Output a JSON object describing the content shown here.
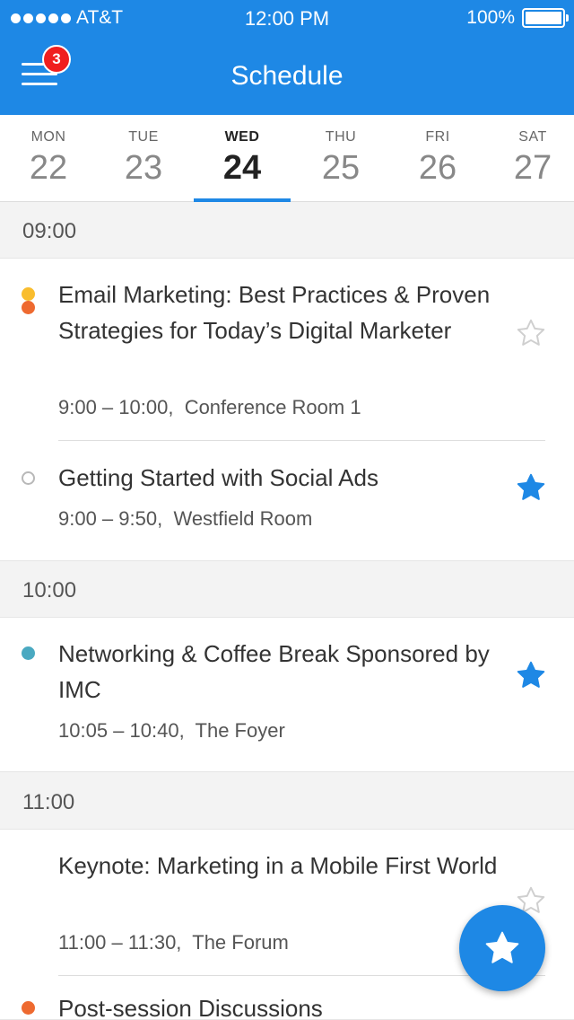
{
  "status_bar": {
    "carrier": "AT&T",
    "time": "12:00 PM",
    "battery": "100%"
  },
  "nav": {
    "title": "Schedule",
    "menu_badge": "3"
  },
  "days": [
    {
      "name": "MON",
      "num": "22",
      "active": false
    },
    {
      "name": "TUE",
      "num": "23",
      "active": false
    },
    {
      "name": "WED",
      "num": "24",
      "active": true
    },
    {
      "name": "THU",
      "num": "25",
      "active": false
    },
    {
      "name": "FRI",
      "num": "26",
      "active": false
    },
    {
      "name": "SAT",
      "num": "27",
      "active": false
    }
  ],
  "sections": [
    {
      "time": "09:00",
      "sessions": [
        {
          "title": "Email Marketing: Best Practices & Proven Strategies for Today’s Digital Marketer",
          "time": "9:00 – 10:00,",
          "room": "Conference Room 1",
          "starred": false,
          "dot_colors": [
            "#f9bd2e",
            "#ee6a30"
          ]
        },
        {
          "title": "Getting Started with Social Ads",
          "time": "9:00 – 9:50,",
          "room": "Westfield Room",
          "starred": true,
          "dot_colors": []
        }
      ]
    },
    {
      "time": "10:00",
      "sessions": [
        {
          "title": "Networking & Coffee Break Sponsored by IMC",
          "time": "10:05 – 10:40,",
          "room": "The Foyer",
          "starred": true,
          "dot_colors": [
            "#4aa9c1"
          ]
        }
      ]
    },
    {
      "time": "11:00",
      "sessions": [
        {
          "title": "Keynote: Marketing in a Mobile First World",
          "time": "11:00 – 11:30,",
          "room": "The Forum",
          "starred": false,
          "dot_colors": []
        },
        {
          "title": "Post-session Discussions",
          "time": "",
          "room": "",
          "starred": false,
          "dot_colors": [
            "#ee6a30"
          ]
        }
      ]
    }
  ],
  "colors": {
    "accent": "#1e88e5",
    "badge": "#f01f1f",
    "star_empty": "#cfcfcf"
  },
  "icons": {
    "menu": "hamburger-menu-icon",
    "star": "star-icon",
    "fab": "favorites-star-icon"
  }
}
